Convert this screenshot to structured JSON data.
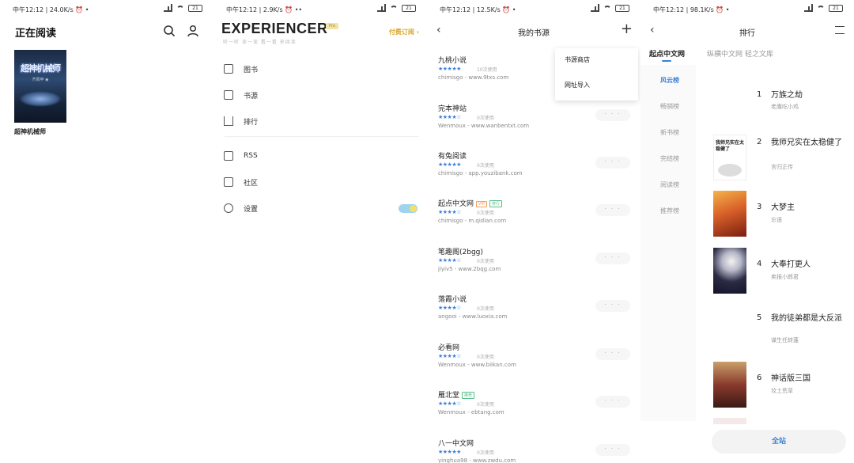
{
  "screens": {
    "s1": {
      "status": {
        "time": "中午12:12 | 24.0K/s ⏰ •",
        "battery": "21"
      },
      "title": "正在阅读",
      "book": {
        "cover_title": "超神机械师",
        "cover_author": "齐佩甲 ◉",
        "name": "超神机械师"
      }
    },
    "s2": {
      "status": {
        "time": "中午12:12 | 2.9K/s ⏰ ••",
        "battery": "21"
      },
      "brand": "EXPERIENCER",
      "pro": "Pro",
      "subline": "听一听 读一读 看一看 来阅读",
      "pay": "付费订阅",
      "menu": [
        {
          "label": "图书",
          "icon": "folder-icon"
        },
        {
          "label": "书源",
          "icon": "terminal-icon"
        },
        {
          "label": "排行",
          "icon": "chart-icon"
        },
        {
          "label": "RSS",
          "icon": "rss-icon"
        },
        {
          "label": "社区",
          "icon": "community-icon"
        },
        {
          "label": "设置",
          "icon": "gear-icon"
        }
      ]
    },
    "s3": {
      "status": {
        "time": "中午12:12 | 12.5K/s ⏰ •",
        "battery": "21"
      },
      "title": "我的书源",
      "popup": [
        "书源商店",
        "网址导入"
      ],
      "sources": [
        {
          "name": "九桃小说",
          "stars": "★★★★★",
          "usage": "10次使用",
          "meta": "chimisgo  -  www.9txs.com",
          "badges": []
        },
        {
          "name": "完本神站",
          "stars": "★★★★☆",
          "usage": "0次使用",
          "meta": "Wenmoux  -  www.wanbentxt.com",
          "badges": []
        },
        {
          "name": "有兔阅读",
          "stars": "★★★★★",
          "usage": "0次使用",
          "meta": "chimisgo  -  app.youzibank.com",
          "badges": []
        },
        {
          "name": "起点中文网",
          "stars": "★★★★☆",
          "usage": "0次使用",
          "meta": "chimisgo  -  m.qidian.com",
          "badges": [
            "VIP",
            "排行"
          ]
        },
        {
          "name": "笔趣阁(2bgg)",
          "stars": "★★★★☆",
          "usage": "0次使用",
          "meta": "jiyiv5  -  www.2bqg.com",
          "badges": []
        },
        {
          "name": "落霞小说",
          "stars": "★★★★☆",
          "usage": "0次使用",
          "meta": "angooi  -  www.luoxia.com",
          "badges": []
        },
        {
          "name": "必看网",
          "stars": "★★★★☆",
          "usage": "0次使用",
          "meta": "Wenmoux  -  www.biikan.com",
          "badges": []
        },
        {
          "name": "雁北堂",
          "stars": "★★★★☆",
          "usage": "0次使用",
          "meta": "Wenmoux  -  ebtang.com",
          "badges": [
            "推荐"
          ]
        },
        {
          "name": "八一中文网",
          "stars": "★★★★★",
          "usage": "0次使用",
          "meta": "yinghua98  -  www.zwdu.com",
          "badges": []
        }
      ],
      "more_label": "· · ·"
    },
    "s4": {
      "status": {
        "time": "中午12:12 | 98.1K/s ⏰ •",
        "battery": "21"
      },
      "title": "排行",
      "tabs": [
        "起点中文网",
        "纵横中文网",
        "轻之文库"
      ],
      "categories": [
        "风云榜",
        "畅销榜",
        "新书榜",
        "完结榜",
        "阅读榜",
        "推荐榜"
      ],
      "ranks": [
        {
          "num": "1",
          "title": "万族之劫",
          "author": "老鹰吃小鸡"
        },
        {
          "num": "2",
          "title": "我师兄实在太稳健了",
          "author": "言归正传"
        },
        {
          "num": "3",
          "title": "大梦主",
          "author": "忘语"
        },
        {
          "num": "4",
          "title": "大奉打更人",
          "author": "卖报小郎君"
        },
        {
          "num": "5",
          "title": "我的徒弟都是大反派",
          "author": "谋生任转蓬"
        },
        {
          "num": "6",
          "title": "神话版三国",
          "author": "坟土荒草"
        }
      ],
      "all_btn": "全站",
      "cover2_text": "我师兄实在太稳健了"
    }
  },
  "colors": {
    "accent": "#3b82d6",
    "gold": "#d8a42a"
  }
}
